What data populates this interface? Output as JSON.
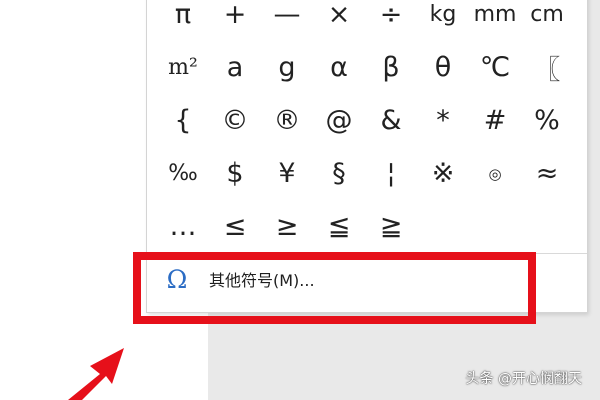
{
  "symbols": {
    "row0": [
      "π",
      "+",
      "—",
      "×",
      "÷",
      "kg",
      "mm",
      "cm"
    ],
    "row1": [
      "m²",
      "a",
      "g",
      "α",
      "β",
      "θ",
      "℃",
      "〖"
    ],
    "row2": [
      "{",
      "©",
      "®",
      "@",
      "&",
      "*",
      "#",
      "%"
    ],
    "row3": [
      "‰",
      "$",
      "¥",
      "§",
      "¦",
      "※",
      "◎",
      "≈"
    ],
    "row4": [
      "…",
      "≤",
      "≥",
      "≦",
      "≧"
    ]
  },
  "more_symbols": {
    "icon": "omega-icon",
    "label": "其他符号(M)..."
  },
  "watermark": "头条 @开心悯翻天",
  "colors": {
    "highlight_border": "#e6101a",
    "omega_blue": "#2b6cc4",
    "arrow_red": "#e6101a"
  }
}
